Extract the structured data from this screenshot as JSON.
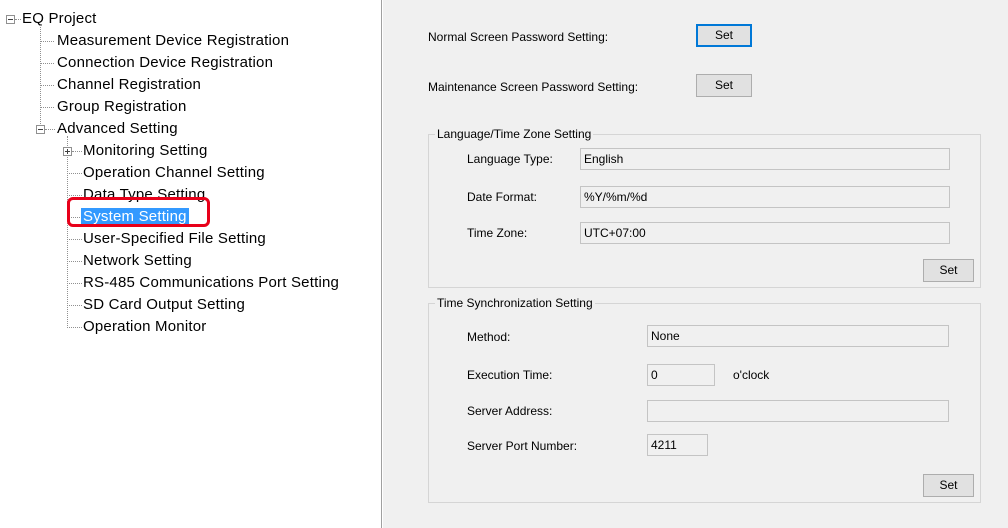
{
  "tree": {
    "root": "EQ Project",
    "items": [
      "Measurement Device Registration",
      "Connection Device Registration",
      "Channel Registration",
      "Group Registration"
    ],
    "advanced": "Advanced Setting",
    "advanced_items": [
      "Monitoring Setting",
      "Operation Channel Setting",
      "Data Type Setting",
      "System Setting",
      "User-Specified File Setting",
      "Network Setting",
      "RS-485 Communications Port Setting",
      "SD Card Output Setting",
      "Operation Monitor"
    ],
    "selected": "System Setting",
    "highlight_color": "#e8001a",
    "selection_color": "#3399ff"
  },
  "settings": {
    "normal_password_label": "Normal Screen Password Setting:",
    "maintenance_password_label": "Maintenance Screen Password Setting:",
    "set_label": "Set",
    "language_group": {
      "title": "Language/Time Zone Setting",
      "language_type_label": "Language Type:",
      "language_type_value": "English",
      "date_format_label": "Date Format:",
      "date_format_value": "%Y/%m/%d",
      "time_zone_label": "Time Zone:",
      "time_zone_value": "UTC+07:00"
    },
    "sync_group": {
      "title": "Time Synchronization Setting",
      "method_label": "Method:",
      "method_value": "None",
      "execution_time_label": "Execution Time:",
      "execution_time_value": "0",
      "execution_time_unit": "o'clock",
      "server_address_label": "Server Address:",
      "server_address_value": "",
      "server_port_label": "Server Port Number:",
      "server_port_value": "4211"
    }
  }
}
